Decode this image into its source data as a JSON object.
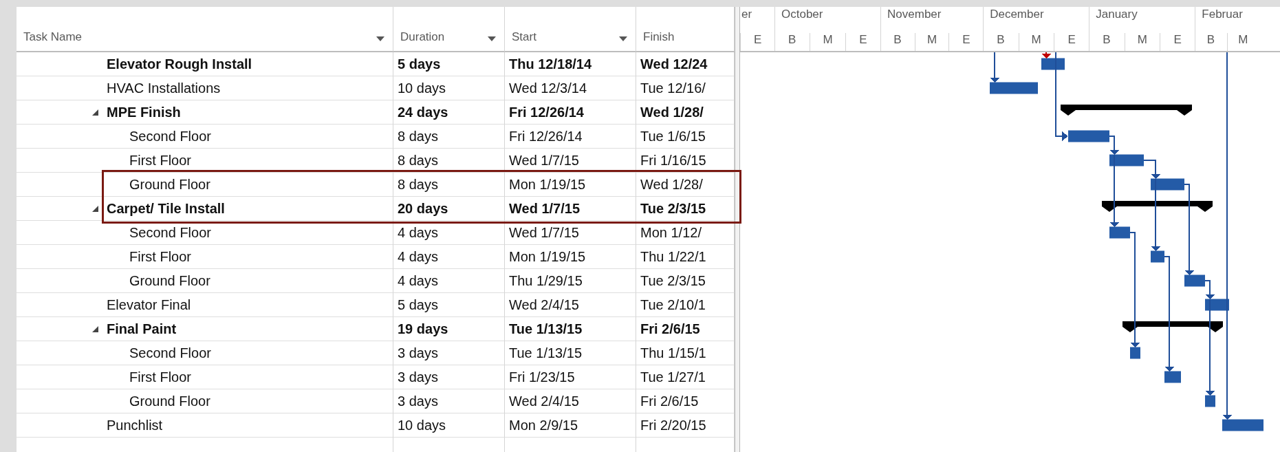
{
  "columns": [
    {
      "label": "Task Name",
      "filter": true
    },
    {
      "label": "Duration",
      "filter": true
    },
    {
      "label": "Start",
      "filter": true
    },
    {
      "label": "Finish",
      "filter": false
    }
  ],
  "timescale": [
    {
      "label": "er",
      "units": [
        "E"
      ]
    },
    {
      "label": "October",
      "units": [
        "B",
        "M",
        "E"
      ]
    },
    {
      "label": "November",
      "units": [
        "B",
        "M",
        "E"
      ]
    },
    {
      "label": "December",
      "units": [
        "B",
        "M",
        "E"
      ]
    },
    {
      "label": "January",
      "units": [
        "B",
        "M",
        "E"
      ]
    },
    {
      "label": "Februar",
      "units": [
        "B",
        "M"
      ]
    }
  ],
  "tasks": [
    {
      "name": "Elevator Rough Install",
      "bold": true,
      "highlighted": false,
      "duration": "5 days",
      "start": "Thu 12/18/14",
      "finish": "Wed 12/24",
      "link": {
        "kind": "from-above",
        "color": "#c00000"
      }
    },
    {
      "name": "HVAC Installations",
      "bold": false,
      "highlighted": false,
      "duration": "10 days",
      "start": "Wed 12/3/14",
      "finish": "Tue 12/16/",
      "link": {
        "kind": "from-above",
        "color": "#1f4e99"
      }
    },
    {
      "name": "MPE Finish",
      "bold": true,
      "highlighted": false,
      "expanded": true,
      "duration": "24 days",
      "start": "Fri 12/26/14",
      "finish": "Wed 1/28/",
      "children": [
        {
          "name": "Second Floor",
          "bold": false,
          "highlighted": false,
          "duration": "8 days",
          "start": "Fri 12/26/14",
          "finish": "Tue 1/6/15",
          "link": {
            "kind": "from-above-side",
            "color": "#1f4e99"
          }
        },
        {
          "name": "First Floor",
          "bold": false,
          "highlighted": false,
          "duration": "8 days",
          "start": "Wed 1/7/15",
          "finish": "Fri 1/16/15",
          "link": {
            "kind": "finish-to-start",
            "color": "#1f4e99"
          }
        },
        {
          "name": "Ground Floor",
          "bold": false,
          "highlighted": true,
          "duration": "8 days",
          "start": "Mon 1/19/15",
          "finish": "Wed 1/28/",
          "link": {
            "kind": "finish-to-start",
            "color": "#1f4e99"
          }
        }
      ]
    },
    {
      "name": "Carpet/ Tile Install",
      "bold": true,
      "highlighted": true,
      "expanded": true,
      "duration": "20 days",
      "start": "Wed 1/7/15",
      "finish": "Tue 2/3/15",
      "children": [
        {
          "name": "Second Floor",
          "bold": false,
          "highlighted": false,
          "duration": "4 days",
          "start": "Wed 1/7/15",
          "finish": "Mon 1/12/",
          "link": {
            "kind": "finish-to-start",
            "color": "#1f4e99"
          }
        },
        {
          "name": "First Floor",
          "bold": false,
          "highlighted": false,
          "duration": "4 days",
          "start": "Mon 1/19/15",
          "finish": "Thu 1/22/1",
          "link": {
            "kind": "finish-to-start",
            "color": "#1f4e99"
          }
        },
        {
          "name": "Ground Floor",
          "bold": false,
          "highlighted": false,
          "duration": "4 days",
          "start": "Thu 1/29/15",
          "finish": "Tue 2/3/15",
          "link": {
            "kind": "finish-to-start",
            "color": "#1f4e99"
          }
        }
      ]
    },
    {
      "name": "Elevator Final",
      "bold": false,
      "highlighted": false,
      "duration": "5 days",
      "start": "Wed 2/4/15",
      "finish": "Tue 2/10/1",
      "link": {
        "kind": "finish-to-start",
        "color": "#1f4e99"
      }
    },
    {
      "name": "Final Paint",
      "bold": true,
      "highlighted": false,
      "expanded": true,
      "duration": "19 days",
      "start": "Tue 1/13/15",
      "finish": "Fri 2/6/15",
      "children": [
        {
          "name": "Second Floor",
          "bold": false,
          "highlighted": false,
          "duration": "3 days",
          "start": "Tue 1/13/15",
          "finish": "Thu 1/15/1",
          "link": {
            "kind": "finish-to-start",
            "color": "#1f4e99"
          }
        },
        {
          "name": "First Floor",
          "bold": false,
          "highlighted": false,
          "duration": "3 days",
          "start": "Fri 1/23/15",
          "finish": "Tue 1/27/1",
          "link": {
            "kind": "finish-to-start",
            "color": "#1f4e99"
          }
        },
        {
          "name": "Ground Floor",
          "bold": false,
          "highlighted": false,
          "duration": "3 days",
          "start": "Wed 2/4/15",
          "finish": "Fri 2/6/15",
          "link": {
            "kind": "finish-to-start",
            "color": "#1f4e99"
          }
        }
      ]
    },
    {
      "name": "Punchlist",
      "bold": false,
      "highlighted": false,
      "duration": "10 days",
      "start": "Mon 2/9/15",
      "finish": "Fri 2/20/15",
      "link": {
        "kind": "from-above",
        "color": "#1f4e99"
      }
    }
  ]
}
